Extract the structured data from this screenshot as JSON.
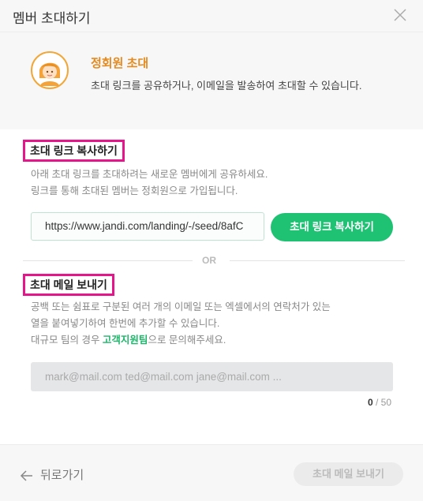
{
  "header": {
    "title": "멤버 초대하기"
  },
  "intro": {
    "title": "정회원 초대",
    "description": "초대 링크를 공유하거나, 이메일을 발송하여 초대할 수 있습니다."
  },
  "link_section": {
    "title": "초대 링크 복사하기",
    "desc_line1": "아래 초대 링크를 초대하려는 새로운 멤버에게 공유하세요.",
    "desc_line2": "링크를 통해 초대된 멤버는 정회원으로 가입됩니다.",
    "link_value": "https://www.jandi.com/landing/-/seed/8afC",
    "copy_button": "초대 링크 복사하기"
  },
  "divider": {
    "label": "OR"
  },
  "email_section": {
    "title": "초대 메일 보내기",
    "desc_line1": "공백 또는 쉼표로 구분된 여러 개의 이메일 또는 엑셀에서의 연락처가 있는",
    "desc_line2": "열을 붙여넣기하여 한번에 추가할 수 있습니다.",
    "desc_line3_prefix": "대규모 팀의 경우 ",
    "support_link": "고객지원팀",
    "desc_line3_suffix": "으로 문의해주세요.",
    "input_placeholder": "mark@mail.com ted@mail.com jane@mail.com ...",
    "count_current": "0",
    "count_max": " / 50"
  },
  "footer": {
    "back_label": "뒤로가기",
    "send_button": "초대 메일 보내기"
  },
  "colors": {
    "accent_green": "#1fc172",
    "orange_title": "#e58a1f",
    "highlight_border": "#e5168c"
  },
  "icons": {
    "close": "close-icon",
    "avatar": "avatar-icon",
    "back": "arrow-left-icon"
  }
}
